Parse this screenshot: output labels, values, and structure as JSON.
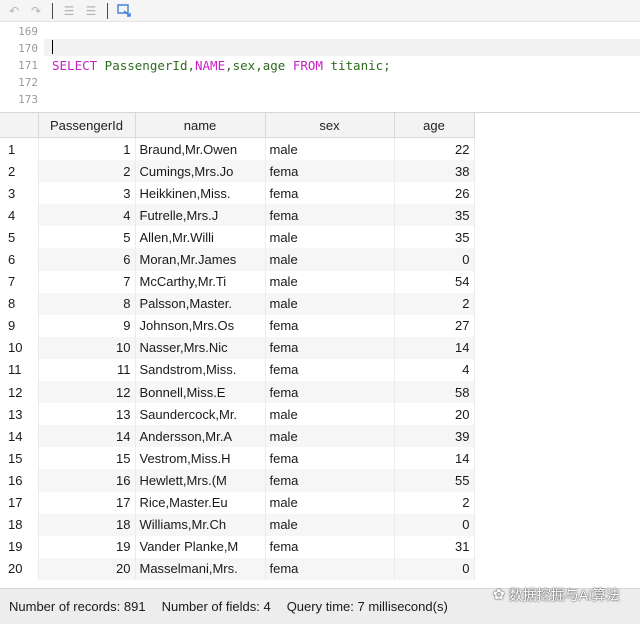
{
  "toolbar": {
    "icons": [
      "undo-icon",
      "redo-icon",
      "indent-icon",
      "outdent-icon",
      "run-to-cursor-icon"
    ]
  },
  "editor": {
    "line_numbers": [
      "169",
      "170",
      "171",
      "172",
      "173"
    ],
    "query": {
      "kw_select": "SELECT",
      "t1": " PassengerId,",
      "kw_name": "NAME",
      "t2": ",sex,age ",
      "kw_from": "FROM",
      "t3": " titanic;"
    }
  },
  "grid": {
    "columns": [
      "",
      "PassengerId",
      "name",
      "sex",
      "age"
    ],
    "rows": [
      {
        "n": "1",
        "id": "1",
        "name": "Braund,Mr.Owen",
        "sex": "male",
        "age": "22"
      },
      {
        "n": "2",
        "id": "2",
        "name": "Cumings,Mrs.Jo",
        "sex": "fema",
        "age": "38"
      },
      {
        "n": "3",
        "id": "3",
        "name": "Heikkinen,Miss.",
        "sex": "fema",
        "age": "26"
      },
      {
        "n": "4",
        "id": "4",
        "name": "Futrelle,Mrs.J",
        "sex": "fema",
        "age": "35"
      },
      {
        "n": "5",
        "id": "5",
        "name": "Allen,Mr.Willi",
        "sex": "male",
        "age": "35"
      },
      {
        "n": "6",
        "id": "6",
        "name": "Moran,Mr.James",
        "sex": "male",
        "age": "0"
      },
      {
        "n": "7",
        "id": "7",
        "name": "McCarthy,Mr.Ti",
        "sex": "male",
        "age": "54"
      },
      {
        "n": "8",
        "id": "8",
        "name": "Palsson,Master.",
        "sex": "male",
        "age": "2"
      },
      {
        "n": "9",
        "id": "9",
        "name": "Johnson,Mrs.Os",
        "sex": "fema",
        "age": "27"
      },
      {
        "n": "10",
        "id": "10",
        "name": "Nasser,Mrs.Nic",
        "sex": "fema",
        "age": "14"
      },
      {
        "n": "11",
        "id": "11",
        "name": "Sandstrom,Miss.",
        "sex": "fema",
        "age": "4"
      },
      {
        "n": "12",
        "id": "12",
        "name": "Bonnell,Miss.E",
        "sex": "fema",
        "age": "58"
      },
      {
        "n": "13",
        "id": "13",
        "name": "Saundercock,Mr.",
        "sex": "male",
        "age": "20"
      },
      {
        "n": "14",
        "id": "14",
        "name": "Andersson,Mr.A",
        "sex": "male",
        "age": "39"
      },
      {
        "n": "15",
        "id": "15",
        "name": "Vestrom,Miss.H",
        "sex": "fema",
        "age": "14"
      },
      {
        "n": "16",
        "id": "16",
        "name": "Hewlett,Mrs.(M",
        "sex": "fema",
        "age": "55"
      },
      {
        "n": "17",
        "id": "17",
        "name": "Rice,Master.Eu",
        "sex": "male",
        "age": "2"
      },
      {
        "n": "18",
        "id": "18",
        "name": "Williams,Mr.Ch",
        "sex": "male",
        "age": "0"
      },
      {
        "n": "19",
        "id": "19",
        "name": "Vander Planke,M",
        "sex": "fema",
        "age": "31"
      },
      {
        "n": "20",
        "id": "20",
        "name": "Masselmani,Mrs.",
        "sex": "fema",
        "age": "0"
      }
    ]
  },
  "status": {
    "records": "Number of records: 891",
    "fields": "Number of fields: 4",
    "query_time": "Query time: 7 millisecond(s)"
  },
  "watermark": {
    "text": "数据挖掘与AI算法",
    "icon": "wechat-icon"
  },
  "colors": {
    "keyword": "#c71fc5",
    "identifier": "#2d6c1e",
    "toolbar_active": "#3b7ddd"
  }
}
